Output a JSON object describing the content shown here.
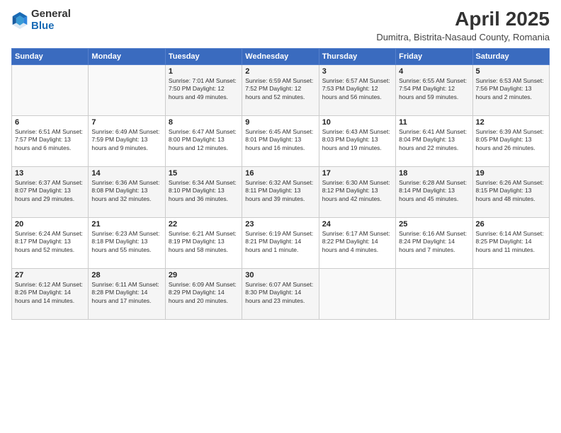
{
  "header": {
    "logo_general": "General",
    "logo_blue": "Blue",
    "month_title": "April 2025",
    "location": "Dumitra, Bistrita-Nasaud County, Romania"
  },
  "days_of_week": [
    "Sunday",
    "Monday",
    "Tuesday",
    "Wednesday",
    "Thursday",
    "Friday",
    "Saturday"
  ],
  "weeks": [
    [
      {
        "day": "",
        "info": ""
      },
      {
        "day": "",
        "info": ""
      },
      {
        "day": "1",
        "info": "Sunrise: 7:01 AM\nSunset: 7:50 PM\nDaylight: 12 hours and 49 minutes."
      },
      {
        "day": "2",
        "info": "Sunrise: 6:59 AM\nSunset: 7:52 PM\nDaylight: 12 hours and 52 minutes."
      },
      {
        "day": "3",
        "info": "Sunrise: 6:57 AM\nSunset: 7:53 PM\nDaylight: 12 hours and 56 minutes."
      },
      {
        "day": "4",
        "info": "Sunrise: 6:55 AM\nSunset: 7:54 PM\nDaylight: 12 hours and 59 minutes."
      },
      {
        "day": "5",
        "info": "Sunrise: 6:53 AM\nSunset: 7:56 PM\nDaylight: 13 hours and 2 minutes."
      }
    ],
    [
      {
        "day": "6",
        "info": "Sunrise: 6:51 AM\nSunset: 7:57 PM\nDaylight: 13 hours and 6 minutes."
      },
      {
        "day": "7",
        "info": "Sunrise: 6:49 AM\nSunset: 7:59 PM\nDaylight: 13 hours and 9 minutes."
      },
      {
        "day": "8",
        "info": "Sunrise: 6:47 AM\nSunset: 8:00 PM\nDaylight: 13 hours and 12 minutes."
      },
      {
        "day": "9",
        "info": "Sunrise: 6:45 AM\nSunset: 8:01 PM\nDaylight: 13 hours and 16 minutes."
      },
      {
        "day": "10",
        "info": "Sunrise: 6:43 AM\nSunset: 8:03 PM\nDaylight: 13 hours and 19 minutes."
      },
      {
        "day": "11",
        "info": "Sunrise: 6:41 AM\nSunset: 8:04 PM\nDaylight: 13 hours and 22 minutes."
      },
      {
        "day": "12",
        "info": "Sunrise: 6:39 AM\nSunset: 8:05 PM\nDaylight: 13 hours and 26 minutes."
      }
    ],
    [
      {
        "day": "13",
        "info": "Sunrise: 6:37 AM\nSunset: 8:07 PM\nDaylight: 13 hours and 29 minutes."
      },
      {
        "day": "14",
        "info": "Sunrise: 6:36 AM\nSunset: 8:08 PM\nDaylight: 13 hours and 32 minutes."
      },
      {
        "day": "15",
        "info": "Sunrise: 6:34 AM\nSunset: 8:10 PM\nDaylight: 13 hours and 36 minutes."
      },
      {
        "day": "16",
        "info": "Sunrise: 6:32 AM\nSunset: 8:11 PM\nDaylight: 13 hours and 39 minutes."
      },
      {
        "day": "17",
        "info": "Sunrise: 6:30 AM\nSunset: 8:12 PM\nDaylight: 13 hours and 42 minutes."
      },
      {
        "day": "18",
        "info": "Sunrise: 6:28 AM\nSunset: 8:14 PM\nDaylight: 13 hours and 45 minutes."
      },
      {
        "day": "19",
        "info": "Sunrise: 6:26 AM\nSunset: 8:15 PM\nDaylight: 13 hours and 48 minutes."
      }
    ],
    [
      {
        "day": "20",
        "info": "Sunrise: 6:24 AM\nSunset: 8:17 PM\nDaylight: 13 hours and 52 minutes."
      },
      {
        "day": "21",
        "info": "Sunrise: 6:23 AM\nSunset: 8:18 PM\nDaylight: 13 hours and 55 minutes."
      },
      {
        "day": "22",
        "info": "Sunrise: 6:21 AM\nSunset: 8:19 PM\nDaylight: 13 hours and 58 minutes."
      },
      {
        "day": "23",
        "info": "Sunrise: 6:19 AM\nSunset: 8:21 PM\nDaylight: 14 hours and 1 minute."
      },
      {
        "day": "24",
        "info": "Sunrise: 6:17 AM\nSunset: 8:22 PM\nDaylight: 14 hours and 4 minutes."
      },
      {
        "day": "25",
        "info": "Sunrise: 6:16 AM\nSunset: 8:24 PM\nDaylight: 14 hours and 7 minutes."
      },
      {
        "day": "26",
        "info": "Sunrise: 6:14 AM\nSunset: 8:25 PM\nDaylight: 14 hours and 11 minutes."
      }
    ],
    [
      {
        "day": "27",
        "info": "Sunrise: 6:12 AM\nSunset: 8:26 PM\nDaylight: 14 hours and 14 minutes."
      },
      {
        "day": "28",
        "info": "Sunrise: 6:11 AM\nSunset: 8:28 PM\nDaylight: 14 hours and 17 minutes."
      },
      {
        "day": "29",
        "info": "Sunrise: 6:09 AM\nSunset: 8:29 PM\nDaylight: 14 hours and 20 minutes."
      },
      {
        "day": "30",
        "info": "Sunrise: 6:07 AM\nSunset: 8:30 PM\nDaylight: 14 hours and 23 minutes."
      },
      {
        "day": "",
        "info": ""
      },
      {
        "day": "",
        "info": ""
      },
      {
        "day": "",
        "info": ""
      }
    ]
  ]
}
